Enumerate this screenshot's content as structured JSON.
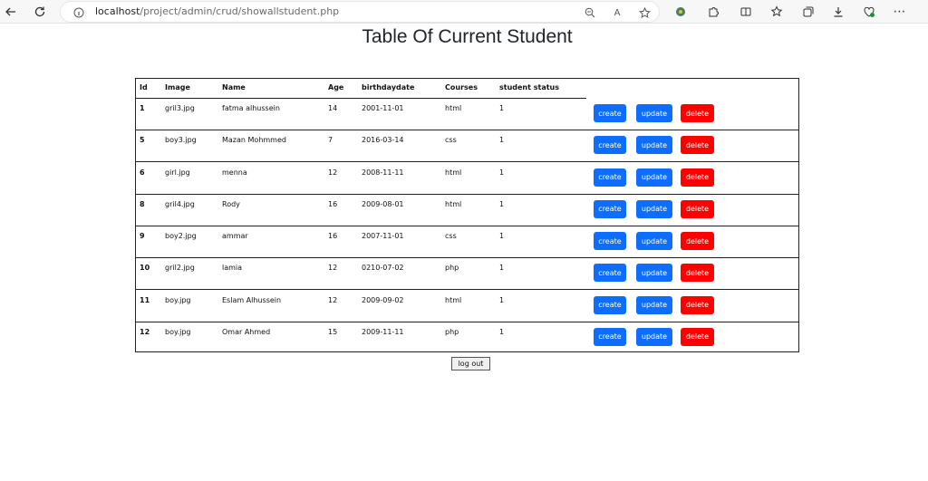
{
  "browser": {
    "url_host": "localhost",
    "url_path": "/project/admin/crud/showallstudent.php",
    "icons": [
      "back-icon",
      "refresh-icon",
      "info-icon",
      "zoom-icon",
      "read-aloud-icon",
      "favorite-star-icon",
      "extension-icon",
      "puzzle-icon",
      "split-screen-icon",
      "favorites-icon",
      "collections-icon",
      "download-icon",
      "performance-icon",
      "more-icon"
    ]
  },
  "page": {
    "title": "Table Of Current Student",
    "logout_label": "log out"
  },
  "table": {
    "headers": [
      "Id",
      "Image",
      "Name",
      "Age",
      "birthdaydate",
      "Courses",
      "student status"
    ],
    "rows": [
      {
        "id": "1",
        "image": "gril3.jpg",
        "name": "fatma alhussein",
        "age": "14",
        "birthdate": "2001-11-01",
        "course": "html",
        "status": "1"
      },
      {
        "id": "5",
        "image": "boy3.jpg",
        "name": "Mazan Mohmmed",
        "age": "7",
        "birthdate": "2016-03-14",
        "course": "css",
        "status": "1"
      },
      {
        "id": "6",
        "image": "girl.jpg",
        "name": "menna",
        "age": "12",
        "birthdate": "2008-11-11",
        "course": "html",
        "status": "1"
      },
      {
        "id": "8",
        "image": "gril4.jpg",
        "name": "Rody",
        "age": "16",
        "birthdate": "2009-08-01",
        "course": "html",
        "status": "1"
      },
      {
        "id": "9",
        "image": "boy2.jpg",
        "name": "ammar",
        "age": "16",
        "birthdate": "2007-11-01",
        "course": "css",
        "status": "1"
      },
      {
        "id": "10",
        "image": "gril2.jpg",
        "name": "lamia",
        "age": "12",
        "birthdate": "0210-07-02",
        "course": "php",
        "status": "1"
      },
      {
        "id": "11",
        "image": "boy.jpg",
        "name": "Eslam Alhussein",
        "age": "12",
        "birthdate": "2009-09-02",
        "course": "html",
        "status": "1"
      },
      {
        "id": "12",
        "image": "boy.jpg",
        "name": "Omar Ahmed",
        "age": "15",
        "birthdate": "2009-11-11",
        "course": "php",
        "status": "1"
      }
    ],
    "actions": {
      "create": "create",
      "update": "update",
      "delete": "delete"
    }
  },
  "colors": {
    "primary": "#0d6efd",
    "danger": "#ff0000"
  }
}
